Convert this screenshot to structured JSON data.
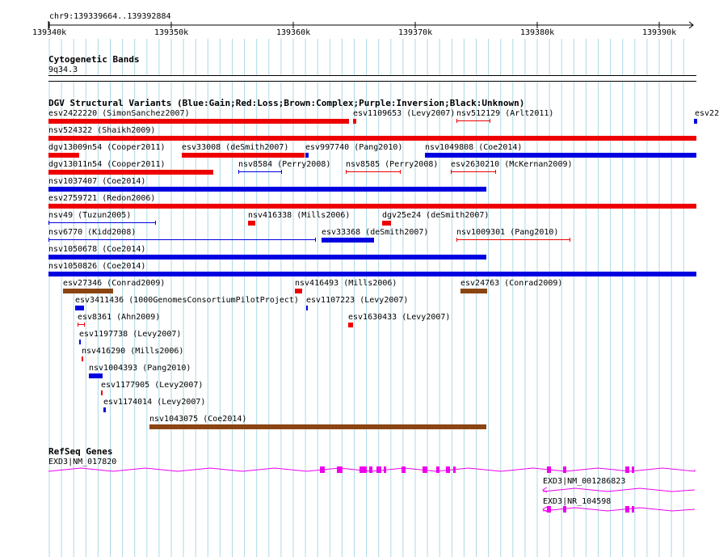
{
  "ruler": {
    "region_label": "chr9:139339664..139392884",
    "ticks": [
      "139340k",
      "139350k",
      "139360k",
      "139370k",
      "139380k",
      "139390k"
    ]
  },
  "tracks": {
    "cytoband_title": "Cytogenetic Bands",
    "cytoband_name": "9q34.3",
    "dgv_title": "DGV Structural Variants (Blue:Gain;Red:Loss;Brown:Complex;Purple:Inversion;Black:Unknown)",
    "refseq_title": "RefSeq Genes"
  },
  "colors": {
    "gain": "#0000e0",
    "loss": "#ee0000",
    "complex": "#8b4513",
    "gene": "#ee00ee",
    "grid": "#add8e6"
  },
  "variants": [
    {
      "label": "esv2422220 (SimonSanchez2007)",
      "type": "loss"
    },
    {
      "label": "esv1109653 (Levy2007)",
      "type": "loss"
    },
    {
      "label": "nsv512129 (Arlt2011)",
      "type": "loss"
    },
    {
      "label": "esv22",
      "type": "gain"
    },
    {
      "label": "nsv524322 (Shaikh2009)",
      "type": "loss"
    },
    {
      "label": "dgv13009n54 (Cooper2011)",
      "type": "loss"
    },
    {
      "label": "esv33008 (deSmith2007)",
      "type": "loss"
    },
    {
      "label": "esv997740 (Pang2010)",
      "type": "gain"
    },
    {
      "label": "nsv1049808 (Coe2014)",
      "type": "gain"
    },
    {
      "label": "dgv13011n54 (Cooper2011)",
      "type": "loss"
    },
    {
      "label": "nsv8584 (Perry2008)",
      "type": "gain"
    },
    {
      "label": "nsv8585 (Perry2008)",
      "type": "loss"
    },
    {
      "label": "esv2630210 (McKernan2009)",
      "type": "loss"
    },
    {
      "label": "nsv1037407 (Coe2014)",
      "type": "gain"
    },
    {
      "label": "esv2759721 (Redon2006)",
      "type": "loss"
    },
    {
      "label": "nsv49 (Tuzun2005)",
      "type": "gain"
    },
    {
      "label": "nsv416338 (Mills2006)",
      "type": "loss"
    },
    {
      "label": "dgv25e24 (deSmith2007)",
      "type": "loss"
    },
    {
      "label": "nsv6770 (Kidd2008)",
      "type": "gain"
    },
    {
      "label": "esv33368 (deSmith2007)",
      "type": "gain"
    },
    {
      "label": "nsv1009301 (Pang2010)",
      "type": "loss"
    },
    {
      "label": "nsv1050678 (Coe2014)",
      "type": "gain"
    },
    {
      "label": "nsv1050826 (Coe2014)",
      "type": "gain"
    },
    {
      "label": "esv27346 (Conrad2009)",
      "type": "complex"
    },
    {
      "label": "nsv416493 (Mills2006)",
      "type": "loss"
    },
    {
      "label": "esv24763 (Conrad2009)",
      "type": "complex"
    },
    {
      "label": "esv3411436 (1000GenomesConsortiumPilotProject)",
      "type": "gain"
    },
    {
      "label": "esv1107223 (Levy2007)",
      "type": "gain"
    },
    {
      "label": "esv8361 (Ahn2009)",
      "type": "loss"
    },
    {
      "label": "esv1630433 (Levy2007)",
      "type": "loss"
    },
    {
      "label": "esv1197738 (Levy2007)",
      "type": "gain"
    },
    {
      "label": "nsv416290 (Mills2006)",
      "type": "loss"
    },
    {
      "label": "nsv1004393 (Pang2010)",
      "type": "gain"
    },
    {
      "label": "esv1177905 (Levy2007)",
      "type": "loss"
    },
    {
      "label": "esv1174014 (Levy2007)",
      "type": "gain"
    },
    {
      "label": "nsv1043075 (Coe2014)",
      "type": "complex"
    }
  ],
  "genes": [
    {
      "label": "EXD3|NM_017820"
    },
    {
      "label": "EXD3|NM_001286823"
    },
    {
      "label": "EXD3|NR_104598"
    }
  ]
}
